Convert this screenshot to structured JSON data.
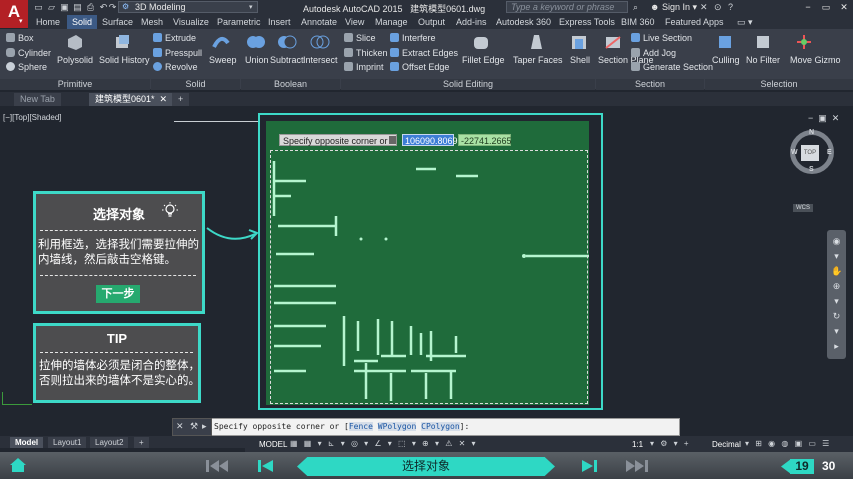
{
  "title_bar": {
    "logo": "A",
    "workspace": "3D Modeling",
    "app_title": "Autodesk AutoCAD 2015",
    "file_name": "建筑模型0601.dwg",
    "search_placeholder": "Type a keyword or phrase",
    "sign_in": "Sign In"
  },
  "ribbon_tabs": [
    "Home",
    "Solid",
    "Surface",
    "Mesh",
    "Visualize",
    "Parametric",
    "Insert",
    "Annotate",
    "View",
    "Manage",
    "Output",
    "Add-ins",
    "Autodesk 360",
    "Express Tools",
    "BIM 360",
    "Featured Apps"
  ],
  "ribbon": {
    "primitive": {
      "title": "Primitive",
      "box": "Box",
      "cylinder": "Cylinder",
      "sphere": "Sphere",
      "polysolid": "Polysolid",
      "solid_history": "Solid History"
    },
    "solid": {
      "title": "Solid",
      "extrude": "Extrude",
      "presspull": "Presspull",
      "revolve": "Revolve",
      "sweep": "Sweep"
    },
    "boolean": {
      "title": "Boolean",
      "union": "Union",
      "subtract": "Subtract",
      "intersect": "Intersect"
    },
    "solid_editing": {
      "title": "Solid Editing",
      "slice": "Slice",
      "thicken": "Thicken",
      "imprint": "Imprint",
      "interfere": "Interfere",
      "extract_edges": "Extract Edges",
      "offset_edge": "Offset Edge",
      "fillet_edge": "Fillet Edge",
      "taper_faces": "Taper Faces",
      "shell": "Shell"
    },
    "section": {
      "title": "Section",
      "section_plane": "Section Plane",
      "live_section": "Live Section",
      "add_jog": "Add Jog",
      "generate_section": "Generate Section"
    },
    "selection": {
      "title": "Selection",
      "culling": "Culling",
      "no_filter": "No Filter",
      "move_gizmo": "Move Gizmo"
    }
  },
  "doc_tabs": {
    "new_tab": "New Tab",
    "active": "建筑模型0601*",
    "add": "+"
  },
  "viewport": {
    "label": "[−][Top][Shaded]",
    "prompt": "Specify opposite corner or",
    "value_x": "106090.8069",
    "value_y": "-22741.2665",
    "compass": {
      "n": "N",
      "s": "S",
      "e": "E",
      "w": "W",
      "cube": "TOP"
    },
    "wcs": "WCS"
  },
  "instruction": {
    "title": "选择对象",
    "text": "利用框选，选择我们需要拉伸的内墙线，然后敲击空格键。",
    "next": "下一步"
  },
  "tip": {
    "title": "TIP",
    "line1": "拉伸的墙体必须是闭合的整体，",
    "line2": "否则拉出来的墙体不是实心的。"
  },
  "command_line": {
    "prefix": "Specify opposite corner or [",
    "fence": "Fence",
    "wpolygon": "WPolygon",
    "cpolygon": "CPolygon",
    "suffix": "]:"
  },
  "layout_tabs": [
    "Model",
    "Layout1",
    "Layout2",
    "+"
  ],
  "status_bar": {
    "model": "MODEL",
    "scale": "1:1",
    "units": "Decimal"
  },
  "footer": {
    "step_title": "选择对象",
    "current_page": "19",
    "total_pages": "30"
  },
  "colors": {
    "accent_teal": "#3dd9c8",
    "plan_green": "#1f6b3b",
    "autocad_red": "#b32025"
  }
}
